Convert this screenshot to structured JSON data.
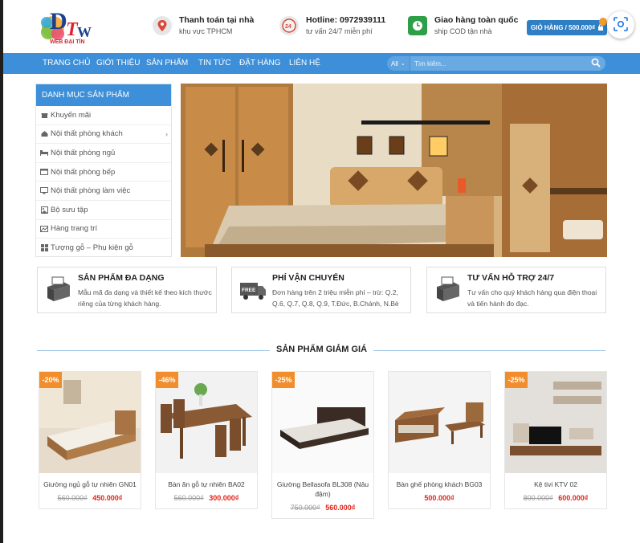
{
  "logo": {
    "text": "WEB ĐẠI TÍN"
  },
  "header": {
    "info": [
      {
        "title": "Thanh toán tại nhà",
        "sub": "khu vực TPHCM",
        "icon": "map-pin-icon"
      },
      {
        "title": "Hotline: 0972939111",
        "sub": "tư vấn 24/7 miễn phí",
        "icon": "phone-24-icon"
      },
      {
        "title": "Giao hàng toàn quốc",
        "sub": "ship COD tận nhà",
        "icon": "delivery-clock-icon"
      }
    ],
    "cart_label": "GIỎ HÀNG / 500.000₫"
  },
  "nav": {
    "items": [
      "TRANG CHỦ",
      "GIỚI THIỆU",
      "SẢN PHẨM",
      "TIN TỨC",
      "ĐẶT HÀNG",
      "LIÊN HỆ"
    ],
    "search_select": "All",
    "search_placeholder": "Tìm kiếm..."
  },
  "sidebar": {
    "title": "DANH MỤC SẢN PHẨM",
    "items": [
      {
        "label": "Khuyến mãi",
        "icon": "gift-icon"
      },
      {
        "label": "Nội thất phòng khách",
        "icon": "home-icon"
      },
      {
        "label": "Nội thất phòng ngủ",
        "icon": "bed-icon"
      },
      {
        "label": "Nội thất phòng bếp",
        "icon": "kitchen-icon"
      },
      {
        "label": "Nội thất phòng làm việc",
        "icon": "desk-icon"
      },
      {
        "label": "Bộ sưu tập",
        "icon": "collection-icon"
      },
      {
        "label": "Hàng trang trí",
        "icon": "decor-icon"
      },
      {
        "label": "Tượng gỗ – Phụ kiện gỗ",
        "icon": "grid-icon"
      }
    ]
  },
  "features": [
    {
      "title": "SẢN PHẨM ĐA DẠNG",
      "desc": "Mẫu mã đa dạng và thiết kế theo kích thước riêng của từng khách hàng.",
      "icon": "fax-machine-icon"
    },
    {
      "title": "PHÍ VẬN CHUYỂN",
      "desc": "Đơn hàng trên 2 triệu miễn phí – trừ: Q.2, Q.6, Q.7, Q.8, Q.9, T.Đức, B.Chánh, N.Bè",
      "icon": "free-truck-icon"
    },
    {
      "title": "TƯ VẤN HỖ TRỢ 24/7",
      "desc": "Tư vấn cho quý khách hàng qua điện thoại và tiến hành đo đạc.",
      "icon": "fax-machine-icon"
    }
  ],
  "section_title": "SẢN PHẨM GIẢM GIÁ",
  "products": [
    {
      "badge": "-20%",
      "name": "Giường ngủ gỗ tự nhiên GN01",
      "old_price": "560.000₫",
      "new_price": "450.000₫"
    },
    {
      "badge": "-46%",
      "name": "Bàn ăn gỗ tự nhiên BA02",
      "old_price": "560.000₫",
      "new_price": "300.000₫"
    },
    {
      "badge": "-25%",
      "name": "Giường Bellasofa BL308 (Nâu đậm)",
      "old_price": "750.000₫",
      "new_price": "560.000₫"
    },
    {
      "badge": "",
      "name": "Bàn ghế phòng khách BG03",
      "old_price": "",
      "new_price": "500.000₫"
    },
    {
      "badge": "-25%",
      "name": "Kệ tivi KTV 02",
      "old_price": "800.000₫",
      "new_price": "600.000₫"
    }
  ]
}
